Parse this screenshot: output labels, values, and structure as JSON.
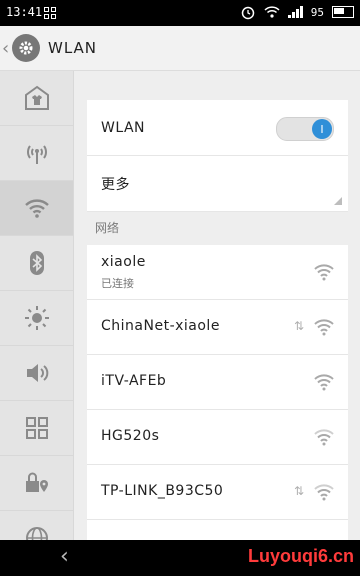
{
  "status_bar": {
    "time": "13:41",
    "right_text": "95"
  },
  "header": {
    "title": "WLAN"
  },
  "sidebar": {
    "items": [
      {
        "icon": "shirt-icon"
      },
      {
        "icon": "antenna-icon"
      },
      {
        "icon": "wifi-icon",
        "active": true
      },
      {
        "icon": "bluetooth-icon"
      },
      {
        "icon": "brightness-icon"
      },
      {
        "icon": "volume-icon"
      },
      {
        "icon": "apps-grid-icon"
      },
      {
        "icon": "lock-location-icon"
      },
      {
        "icon": "globe-icon"
      }
    ]
  },
  "wlan_card": {
    "wlan_label": "WLAN",
    "toggle_state": "I",
    "more_label": "更多"
  },
  "section": {
    "label": "网络"
  },
  "networks": [
    {
      "name": "xiaole",
      "status": "已连接",
      "wps": false
    },
    {
      "name": "ChinaNet-xiaole",
      "status": "",
      "wps": true
    },
    {
      "name": "iTV-AFEb",
      "status": "",
      "wps": false
    },
    {
      "name": "HG520s",
      "status": "",
      "wps": false
    },
    {
      "name": "TP-LINK_B93C50",
      "status": "",
      "wps": true
    }
  ],
  "nav": {
    "back": "‹"
  },
  "watermark": "Luyouqi6.cn"
}
